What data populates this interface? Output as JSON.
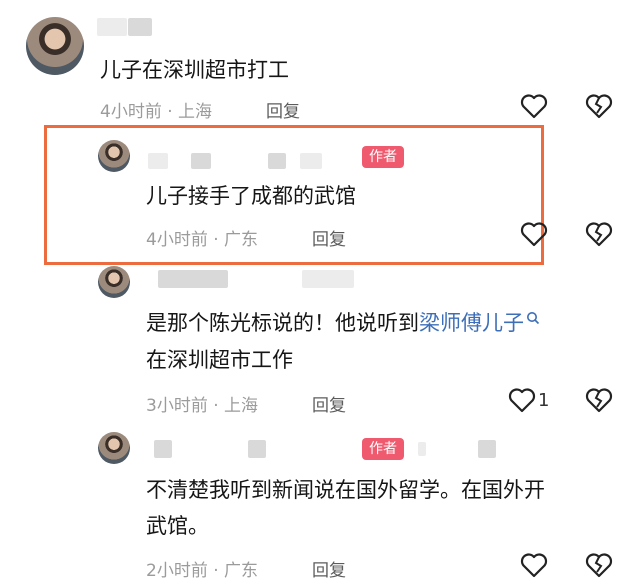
{
  "comments": [
    {
      "text": "儿子在深圳超市打工",
      "meta": "4小时前 · 上海",
      "reply": "回复"
    },
    {
      "badge": "作者",
      "text": "儿子接手了成都的武馆",
      "meta": "4小时前 · 广东",
      "reply": "回复"
    },
    {
      "text_pre": "是那个陈光标说的！他说听到",
      "text_link": "梁师傅儿子",
      "text_line2": "在深圳超市工作",
      "meta": "3小时前 · 上海",
      "reply": "回复",
      "like_count": "1"
    },
    {
      "badge": "作者",
      "text_line1": "不清楚我听到新闻说在国外留学。在国外开",
      "text_line2": "武馆。",
      "meta": "2小时前 · 广东",
      "reply": "回复"
    }
  ],
  "colors": {
    "highlight": "#ed6c3f",
    "badge": "#ef5a6f",
    "link": "#3d6fb8"
  },
  "icons": [
    "heart-icon",
    "broken-heart-icon",
    "search-icon"
  ]
}
